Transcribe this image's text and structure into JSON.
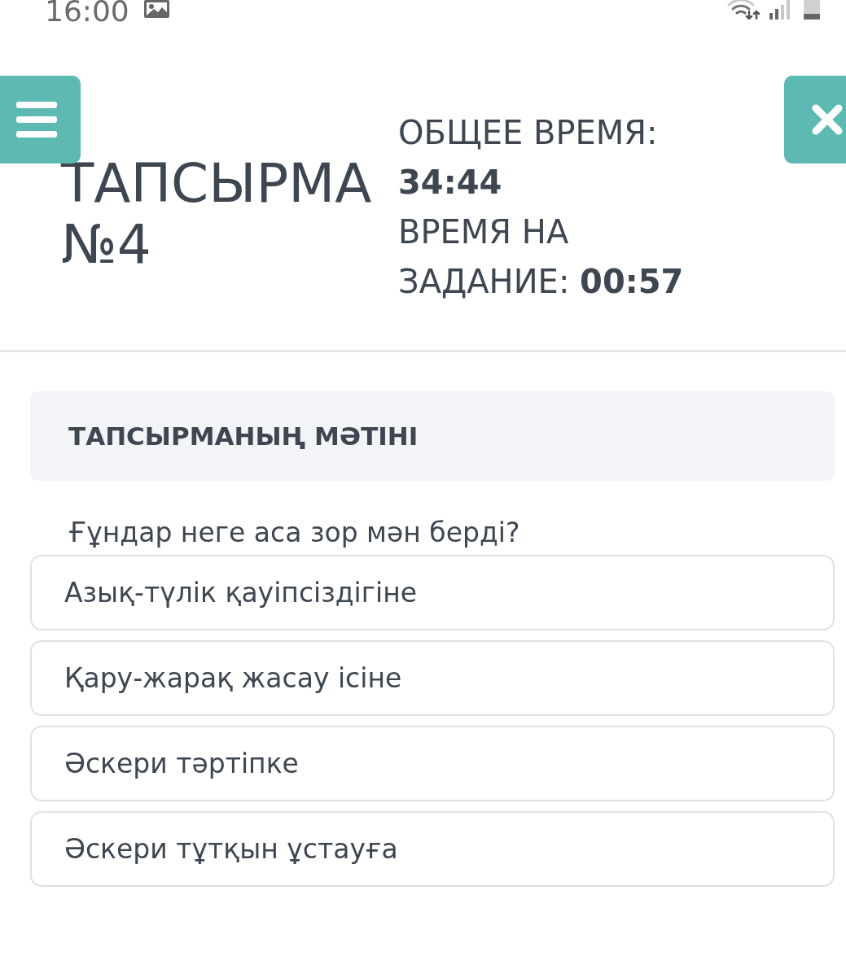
{
  "status_bar": {
    "time": "16:00"
  },
  "header": {
    "title": "ТАПСЫРМА №4",
    "timers": [
      "ОБЩЕЕ ВРЕМЯ: **34:44**",
      "ВРЕМЯ НА ЗАДАНИЕ: **00:57**"
    ]
  },
  "task": {
    "heading": "ТАПСЫРМАНЫҢ МӘТІНІ",
    "question": "Ғұндар неге аса зор мән берді?",
    "options": [
      {
        "label": "Азық-түлік қауіпсіздігіне",
        "selected": false
      },
      {
        "label": "Қару-жарақ жасау ісіне",
        "selected": false
      },
      {
        "label": "Әскери тәртіпке",
        "selected": false
      },
      {
        "label": "Әскери тұтқын ұстауға",
        "selected": false
      }
    ]
  }
}
